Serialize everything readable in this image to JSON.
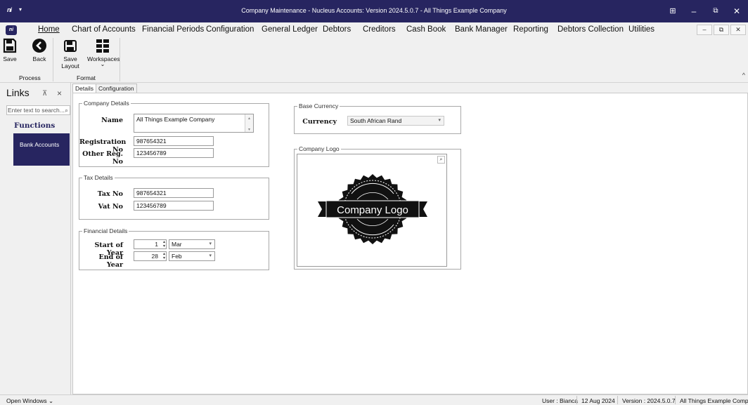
{
  "window": {
    "title": "Company Maintenance - Nucleus Accounts: Version 2024.5.0.7 - All Things Example Company",
    "app_icon_text": "ni",
    "controls": {
      "grid": "⊞",
      "minimize": "–",
      "restore": "⧉",
      "close": "✕"
    },
    "background_color": "#272560"
  },
  "menu": {
    "logo_text": "ni",
    "items": [
      "Home",
      "Chart of Accounts",
      "Financial Periods",
      "Configuration",
      "General Ledger",
      "Debtors",
      "Creditors",
      "Cash Book",
      "Bank Manager",
      "Reporting",
      "Debtors Collection",
      "Utilities"
    ],
    "active": "Home",
    "mdi_controls": {
      "minimize": "–",
      "restore": "⧉",
      "close": "✕"
    }
  },
  "ribbon": {
    "buttons": [
      {
        "label": "Save",
        "icon": "save-icon"
      },
      {
        "label": "Back",
        "icon": "back-arrow-icon"
      },
      {
        "label": "Save Layout",
        "icon": "save-layout-icon"
      },
      {
        "label": "Workspaces",
        "icon": "workspaces-grid-icon",
        "dropdown": "⌄"
      }
    ],
    "groups": [
      "Process",
      "Format"
    ],
    "collapse_glyph": "^"
  },
  "links_panel": {
    "title": "Links",
    "pin_glyph": "⊼",
    "close_glyph": "×",
    "search_placeholder": "Enter text to search...",
    "search_icon": "⌕",
    "section_heading": "Functions",
    "tiles": [
      "Bank Accounts"
    ],
    "tile_color": "#272560"
  },
  "tabs": [
    "Details",
    "Configuration"
  ],
  "active_tab": "Details",
  "company_details": {
    "group_title": "Company Details",
    "name_label": "Name",
    "name_value": "All Things Example Company",
    "registration_label": "Registration No",
    "registration_value": "987654321",
    "other_reg_label": "Other Reg. No",
    "other_reg_value": "123456789"
  },
  "tax_details": {
    "group_title": "Tax Details",
    "tax_label": "Tax No",
    "tax_value": "987654321",
    "vat_label": "Vat No",
    "vat_value": "123456789"
  },
  "financial_details": {
    "group_title": "Financial Details",
    "start_label": "Start of Year",
    "start_day": "1",
    "start_month": "Mar",
    "end_label": "End of Year",
    "end_day": "28",
    "end_month": "Feb"
  },
  "base_currency": {
    "group_title": "Base Currency",
    "currency_label": "Currency",
    "currency_value": "South African Rand"
  },
  "company_logo": {
    "group_title": "Company Logo",
    "logo_text": "Company Logo",
    "zoom_icon": "⌕"
  },
  "statusbar": {
    "open_windows": "Open Windows ⌄",
    "user": "User : Bianca",
    "date": "12 Aug 2024",
    "version": "Version : 2024.5.0.7",
    "company": "All Things Example Company"
  }
}
